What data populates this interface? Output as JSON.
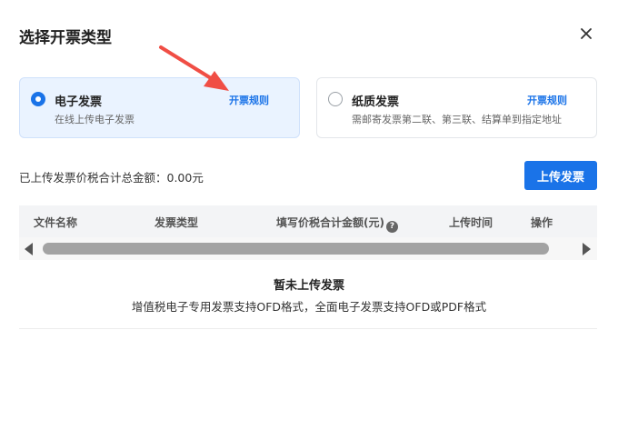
{
  "dialog": {
    "title": "选择开票类型",
    "close_icon": "close-icon"
  },
  "options": [
    {
      "name": "电子发票",
      "desc": "在线上传电子发票",
      "rule_label": "开票规则",
      "selected": true
    },
    {
      "name": "纸质发票",
      "desc": "需邮寄发票第二联、第三联、结算单到指定地址",
      "rule_label": "开票规则",
      "selected": false
    }
  ],
  "summary": {
    "total_label": "已上传发票价税合计总金额：0.00元"
  },
  "toolbar": {
    "upload_label": "上传发票"
  },
  "table": {
    "columns": [
      "文件名称",
      "发票类型",
      "填写价税合计金额(元)",
      "上传时间",
      "操作"
    ],
    "help_icon": "question-circle-icon",
    "help_icon_glyph": "?"
  },
  "empty": {
    "title": "暂未上传发票",
    "desc": "增值税电子专用发票支持OFD格式，全面电子发票支持OFD或PDF格式"
  },
  "colors": {
    "accent": "#1a73e8",
    "arrow": "#f04e45",
    "selected_card_bg": "#eaf3ff"
  }
}
